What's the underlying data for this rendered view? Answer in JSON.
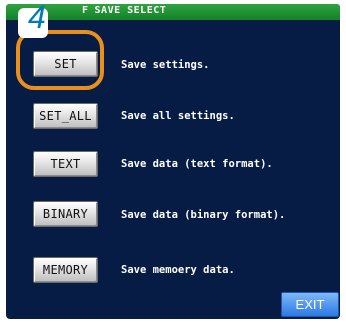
{
  "titlebar": {
    "prefix": "F",
    "title": "SAVE SELECT"
  },
  "step_marker": "4",
  "options": [
    {
      "button": "SET",
      "description": "Save settings."
    },
    {
      "button": "SET_ALL",
      "description": "Save all settings."
    },
    {
      "button": "TEXT",
      "description": "Save data (text format)."
    },
    {
      "button": "BINARY",
      "description": "Save data (binary format)."
    },
    {
      "button": "MEMORY",
      "description": "Save memoery data."
    }
  ],
  "exit_label": "EXIT",
  "colors": {
    "screen_bg": "#071c45",
    "titlebar": "#13822a",
    "exit_button": "#2a79e4",
    "highlight_ring": "#e9901c",
    "step_number": "#0079b6"
  }
}
